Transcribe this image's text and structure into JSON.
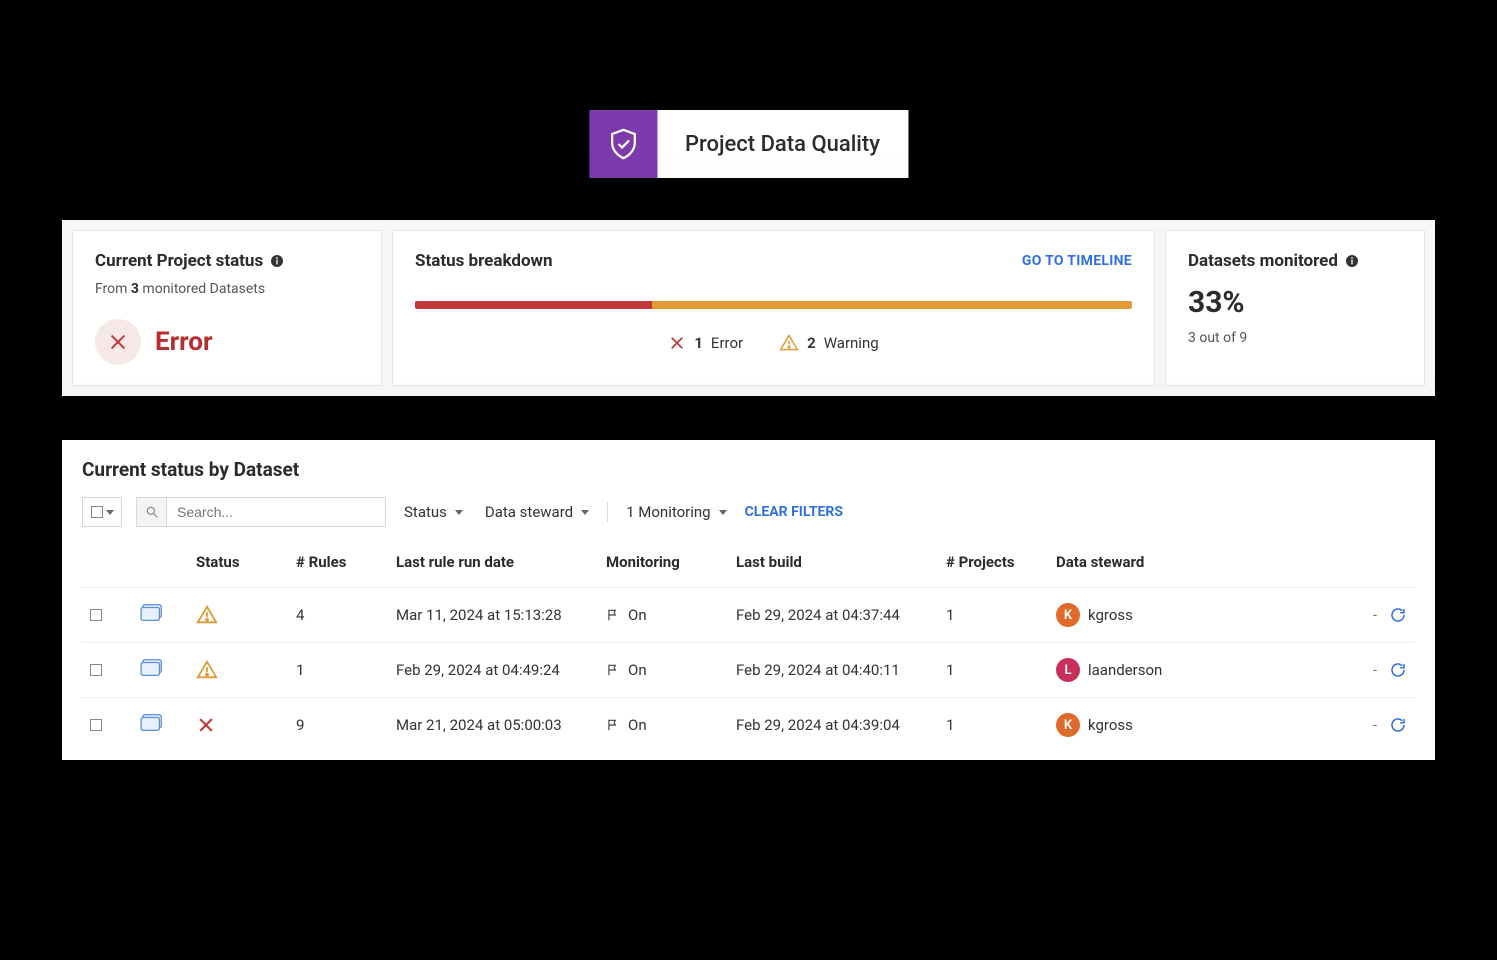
{
  "header": {
    "title": "Project Data Quality"
  },
  "status_card": {
    "title": "Current Project status",
    "sub_prefix": "From ",
    "sub_count": "3",
    "sub_suffix": " monitored Datasets",
    "status_word": "Error"
  },
  "breakdown_card": {
    "title": "Status breakdown",
    "timeline_link": "GO TO TIMELINE",
    "error_count": "1",
    "error_label": "Error",
    "warn_count": "2",
    "warn_label": "Warning",
    "error_pct": 33,
    "warn_pct": 67
  },
  "monitor_card": {
    "title": "Datasets monitored",
    "percent": "33%",
    "sub": "3 out of 9"
  },
  "table_panel": {
    "title": "Current status by Dataset",
    "search_placeholder": "Search...",
    "filter_status": "Status",
    "filter_steward": "Data steward",
    "filter_monitoring": "1 Monitoring",
    "clear_filters": "CLEAR FILTERS",
    "columns": {
      "status": "Status",
      "rules": "# Rules",
      "last_run": "Last rule run date",
      "monitoring": "Monitoring",
      "last_build": "Last build",
      "projects": "# Projects",
      "steward": "Data steward"
    },
    "rows": [
      {
        "status": "warning",
        "rules": "4",
        "last_run": "Mar 11, 2024 at 15:13:28",
        "monitoring": "On",
        "last_build": "Feb 29, 2024 at 04:37:44",
        "projects": "1",
        "steward": "kgross",
        "avatar": "K",
        "avatar_color": "orange"
      },
      {
        "status": "warning",
        "rules": "1",
        "last_run": "Feb 29, 2024 at 04:49:24",
        "monitoring": "On",
        "last_build": "Feb 29, 2024 at 04:40:11",
        "projects": "1",
        "steward": "laanderson",
        "avatar": "L",
        "avatar_color": "red"
      },
      {
        "status": "error",
        "rules": "9",
        "last_run": "Mar 21, 2024 at 05:00:03",
        "monitoring": "On",
        "last_build": "Feb 29, 2024 at 04:39:04",
        "projects": "1",
        "steward": "kgross",
        "avatar": "K",
        "avatar_color": "orange"
      }
    ]
  }
}
